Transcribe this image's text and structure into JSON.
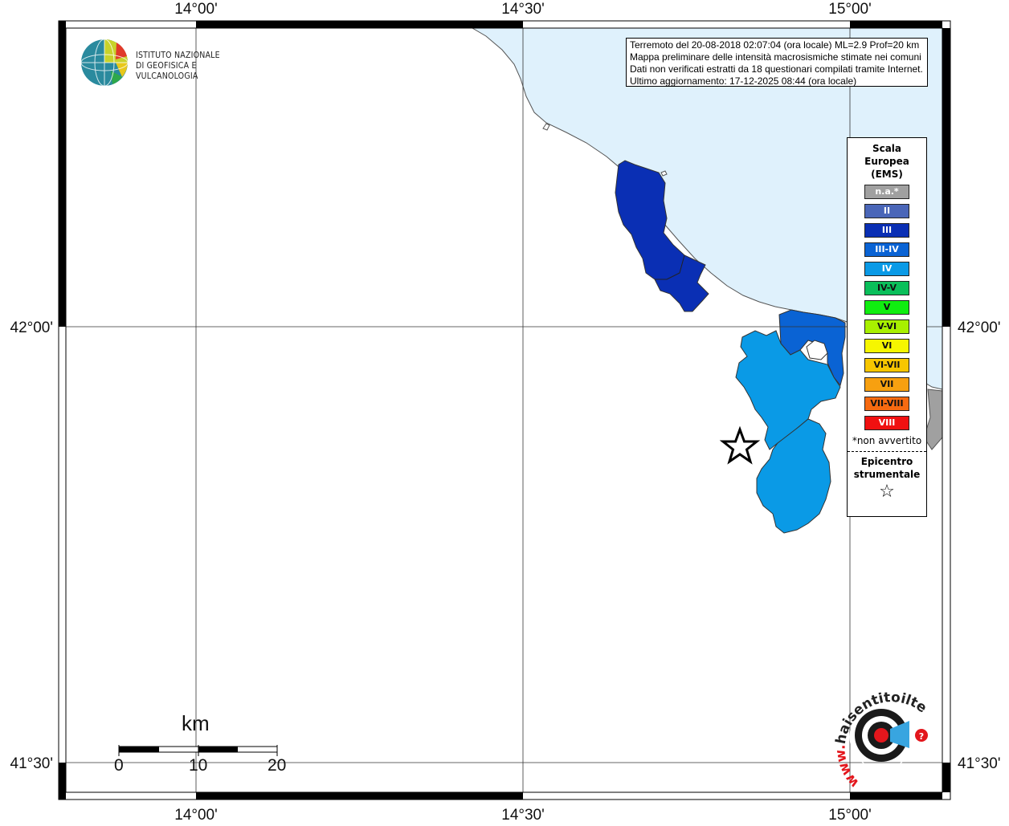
{
  "map": {
    "top_axis_labels": [
      "14°00'",
      "14°30'",
      "15°00'"
    ],
    "bottom_axis_labels": [
      "14°00'",
      "14°30'",
      "15°00'"
    ],
    "left_axis_labels": [
      "42°00'",
      "41°30'"
    ],
    "right_axis_labels": [
      "42°00'",
      "41°30'"
    ]
  },
  "logo": {
    "line1": "ISTITUTO NAZIONALE",
    "line2": "DI GEOFISICA E VULCANOLOGIA"
  },
  "info": {
    "line1": "Terremoto del 20-08-2018 02:07:04 (ora locale) ML=2.9 Prof=20 km",
    "line2": "Mappa preliminare delle intensità macrosismiche stimate nei comuni",
    "line3": "Dati non verificati estratti da 18 questionari compilati tramite Internet.",
    "line4": "Ultimo aggiornamento: 17-12-2025 08:44 (ora locale)"
  },
  "legend": {
    "title_line1": "Scala",
    "title_line2": "Europea",
    "title_line3": "(EMS)",
    "items": [
      {
        "label": "n.a.*",
        "color": "#a0a0a0",
        "text_color": "#ffffff"
      },
      {
        "label": "II",
        "color": "#4a66b8",
        "text_color": "#ffffff"
      },
      {
        "label": "III",
        "color": "#0a2fb4",
        "text_color": "#ffffff"
      },
      {
        "label": "III-IV",
        "color": "#0a63d4",
        "text_color": "#ffffff"
      },
      {
        "label": "IV",
        "color": "#0a9ae6",
        "text_color": "#ffffff"
      },
      {
        "label": "IV-V",
        "color": "#0abf5a",
        "text_color": "#111111"
      },
      {
        "label": "V",
        "color": "#10ee10",
        "text_color": "#111111"
      },
      {
        "label": "V-VI",
        "color": "#a8f000",
        "text_color": "#111111"
      },
      {
        "label": "VI",
        "color": "#f6f600",
        "text_color": "#111111"
      },
      {
        "label": "VI-VII",
        "color": "#f7c600",
        "text_color": "#111111"
      },
      {
        "label": "VII",
        "color": "#f7a010",
        "text_color": "#111111"
      },
      {
        "label": "VII-VIII",
        "color": "#f76a10",
        "text_color": "#111111"
      },
      {
        "label": "VIII",
        "color": "#f01010",
        "text_color": "#ffffff"
      }
    ],
    "note": "*non avvertito",
    "epicenter_line1": "Epicentro",
    "epicenter_line2": "strumentale",
    "epicenter_symbol": "☆"
  },
  "scalebar": {
    "unit": "km",
    "ticks": [
      "0",
      "10",
      "20"
    ]
  },
  "watermark": {
    "text": "haisentitoilterremoto.it",
    "prefix": "www."
  },
  "colors": {
    "sea": "#dff1fc",
    "coast": "#555555",
    "intensity_III": "#0a2fb4",
    "intensity_III_IV": "#0a63d4",
    "intensity_IV": "#0a9ae6",
    "not_felt": "#a0a0a0"
  }
}
